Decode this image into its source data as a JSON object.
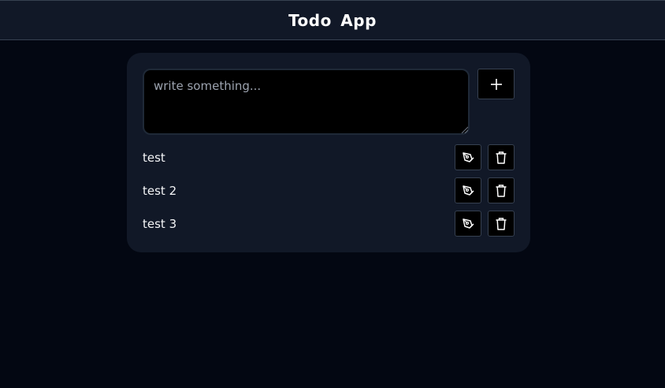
{
  "app": {
    "title": "Todo App"
  },
  "composer": {
    "placeholder": "write something...",
    "value": "",
    "add_icon": "plus-icon"
  },
  "todos": [
    {
      "text": "test",
      "edit_icon": "pen-icon",
      "delete_icon": "trash-icon"
    },
    {
      "text": "test 2",
      "edit_icon": "pen-icon",
      "delete_icon": "trash-icon"
    },
    {
      "text": "test 3",
      "edit_icon": "pen-icon",
      "delete_icon": "trash-icon"
    }
  ],
  "colors": {
    "background": "#030712",
    "header": "#111827",
    "card": "#111827",
    "input_bg": "#000000",
    "text": "#f3f4f6",
    "placeholder": "#9ca3af"
  }
}
